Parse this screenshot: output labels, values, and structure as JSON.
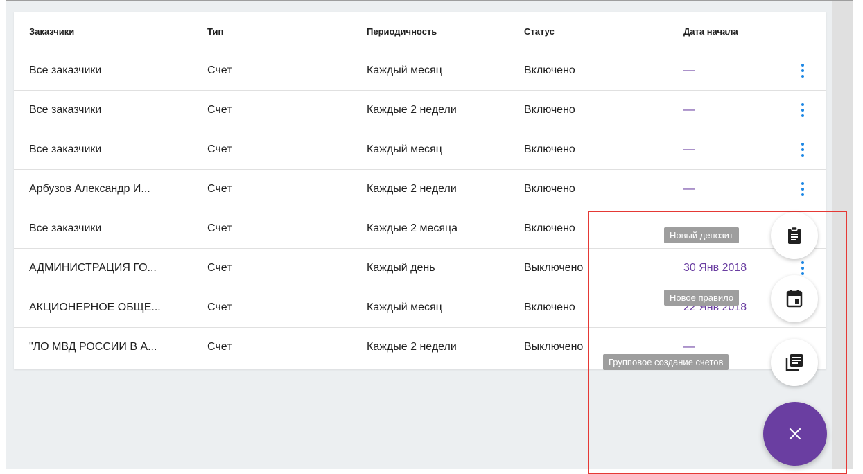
{
  "table": {
    "headers": {
      "customers": "Заказчики",
      "type": "Тип",
      "periodicity": "Периодичность",
      "status": "Статус",
      "start_date": "Дата начала"
    },
    "rows": [
      {
        "customer": "Все заказчики",
        "type": "Счет",
        "periodicity": "Каждый месяц",
        "status": "Включено",
        "start_date": "—"
      },
      {
        "customer": "Все заказчики",
        "type": "Счет",
        "periodicity": "Каждые 2 недели",
        "status": "Включено",
        "start_date": "—"
      },
      {
        "customer": "Все заказчики",
        "type": "Счет",
        "periodicity": "Каждый месяц",
        "status": "Включено",
        "start_date": "—"
      },
      {
        "customer": "Арбузов Александр И...",
        "type": "Счет",
        "periodicity": "Каждые 2 недели",
        "status": "Включено",
        "start_date": "—"
      },
      {
        "customer": "Все заказчики",
        "type": "Счет",
        "periodicity": "Каждые 2 месяца",
        "status": "Включено",
        "start_date": ""
      },
      {
        "customer": "АДМИНИСТРАЦИЯ ГО...",
        "type": "Счет",
        "periodicity": "Каждый день",
        "status": "Выключено",
        "start_date": "30 Янв 2018"
      },
      {
        "customer": "АКЦИОНЕРНОЕ ОБЩЕ...",
        "type": "Счет",
        "periodicity": "Каждый месяц",
        "status": "Включено",
        "start_date": "22 Янв 2018"
      },
      {
        "customer": "\"ЛО МВД РОССИИ В А...",
        "type": "Счет",
        "periodicity": "Каждые 2 недели",
        "status": "Выключено",
        "start_date": "—"
      }
    ]
  },
  "fab_menu": {
    "new_deposit": "Новый депозит",
    "new_rule": "Новое правило",
    "bulk_invoices": "Групповое создание счетов",
    "close_icon": "close-icon"
  },
  "colors": {
    "accent": "#6a3ea1",
    "menu_dots": "#1e88e5",
    "highlight": "#e53935"
  }
}
